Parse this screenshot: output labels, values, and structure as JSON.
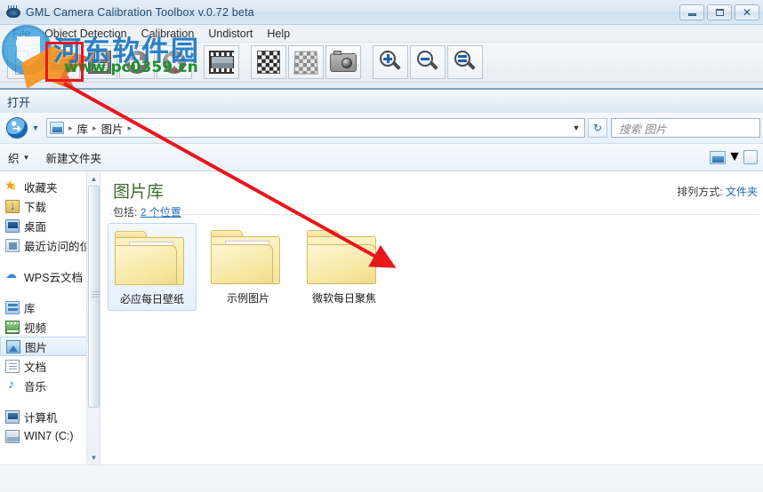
{
  "app": {
    "title": "GML Camera Calibration Toolbox  v.0.72 beta",
    "icon": "camera-eye-icon",
    "window_controls": [
      {
        "name": "minimize",
        "glyph": "—"
      },
      {
        "name": "restore",
        "glyph": "❐"
      },
      {
        "name": "close",
        "glyph": "✕"
      }
    ],
    "menu": [
      {
        "label": "File",
        "name": "menu-file"
      },
      {
        "label": "Object Detection",
        "name": "menu-object-detection"
      },
      {
        "label": "Calibration",
        "name": "menu-calibration"
      },
      {
        "label": "Undistort",
        "name": "menu-undistort"
      },
      {
        "label": "Help",
        "name": "menu-help"
      }
    ],
    "toolbar": [
      {
        "name": "new-document-button",
        "icon": "new-document-icon"
      },
      {
        "name": "open-file-button",
        "icon": "open-folder-icon",
        "highlighted": true
      },
      {
        "name": "save-button",
        "icon": "floppy-save-icon"
      },
      {
        "name": "add-button",
        "icon": "plus-circle-icon"
      },
      {
        "name": "remove-button",
        "icon": "cross-circle-icon"
      },
      {
        "name": "video-button",
        "icon": "film-strip-icon"
      },
      {
        "name": "chessboard-button",
        "icon": "checkerboard-icon"
      },
      {
        "name": "chessboard-grey-button",
        "icon": "checkerboard-grey-icon"
      },
      {
        "name": "camera-button",
        "icon": "camera-icon"
      },
      {
        "name": "zoom-in-button",
        "icon": "zoom-in-icon"
      },
      {
        "name": "zoom-out-button",
        "icon": "zoom-out-icon"
      },
      {
        "name": "zoom-fit-button",
        "icon": "zoom-reset-icon"
      }
    ]
  },
  "watermark": {
    "site_name": "河东软件园",
    "url_left": "www.pc0359",
    "url_dot": ".",
    "url_right": "cn"
  },
  "dialog": {
    "title": "打开",
    "nav": {
      "back_glyph": "➜",
      "history_glyph": "▼"
    },
    "address": {
      "icon": "library-icon",
      "crumbs": [
        "库",
        "图片"
      ],
      "separator": "▸",
      "dropdown_glyph": "▼",
      "refresh_glyph": "↻"
    },
    "search": {
      "placeholder": "搜索 图片"
    },
    "commandbar": {
      "organize_label": "织",
      "organize_caret": "▼",
      "new_folder_label": "新建文件夹",
      "view_icon": "view-options-icon",
      "view_caret": "▼",
      "help_icon": "help-icon"
    },
    "sidebar": {
      "groups": [
        {
          "items": [
            {
              "label": "收藏夹",
              "icon": "favorites-icon",
              "name": "sidebar-item-favorites"
            },
            {
              "label": "下载",
              "icon": "downloads-icon",
              "name": "sidebar-item-downloads"
            },
            {
              "label": "桌面",
              "icon": "desktop-icon",
              "name": "sidebar-item-desktop"
            },
            {
              "label": "最近访问的位置",
              "icon": "recent-places-icon",
              "name": "sidebar-item-recent-places"
            }
          ]
        },
        {
          "items": [
            {
              "label": "WPS云文档",
              "icon": "cloud-icon",
              "name": "sidebar-item-wps-cloud"
            }
          ]
        },
        {
          "items": [
            {
              "label": "库",
              "icon": "libraries-icon",
              "name": "sidebar-item-libraries"
            },
            {
              "label": "视频",
              "icon": "videos-icon",
              "name": "sidebar-item-videos"
            },
            {
              "label": "图片",
              "icon": "pictures-icon",
              "name": "sidebar-item-pictures",
              "selected": true
            },
            {
              "label": "文档",
              "icon": "documents-icon",
              "name": "sidebar-item-documents"
            },
            {
              "label": "音乐",
              "icon": "music-icon",
              "name": "sidebar-item-music"
            }
          ]
        },
        {
          "items": [
            {
              "label": "计算机",
              "icon": "computer-icon",
              "name": "sidebar-item-computer"
            },
            {
              "label": "WIN7 (C:)",
              "icon": "drive-icon",
              "name": "sidebar-item-drive-c"
            }
          ]
        }
      ],
      "scroll_up_glyph": "▲",
      "scroll_down_glyph": "▼"
    },
    "content": {
      "library_title": "图片库",
      "includes_prefix": "包括:",
      "includes_link": "2 个位置",
      "arrange_label": "排列方式:",
      "arrange_value": "文件夹",
      "items": [
        {
          "label": "必应每日壁纸",
          "thumb": "bing-wallpaper-thumb",
          "selected": true
        },
        {
          "label": "示例图片",
          "thumb": "sample-pictures-thumb",
          "selected": false
        },
        {
          "label": "微软每日聚焦",
          "thumb": "empty-folder-thumb",
          "selected": false
        }
      ]
    }
  },
  "annotations": {
    "highlight_box": "red-highlight-rectangle",
    "arrow": "red-pointer-arrow",
    "color": "#e8171c"
  }
}
